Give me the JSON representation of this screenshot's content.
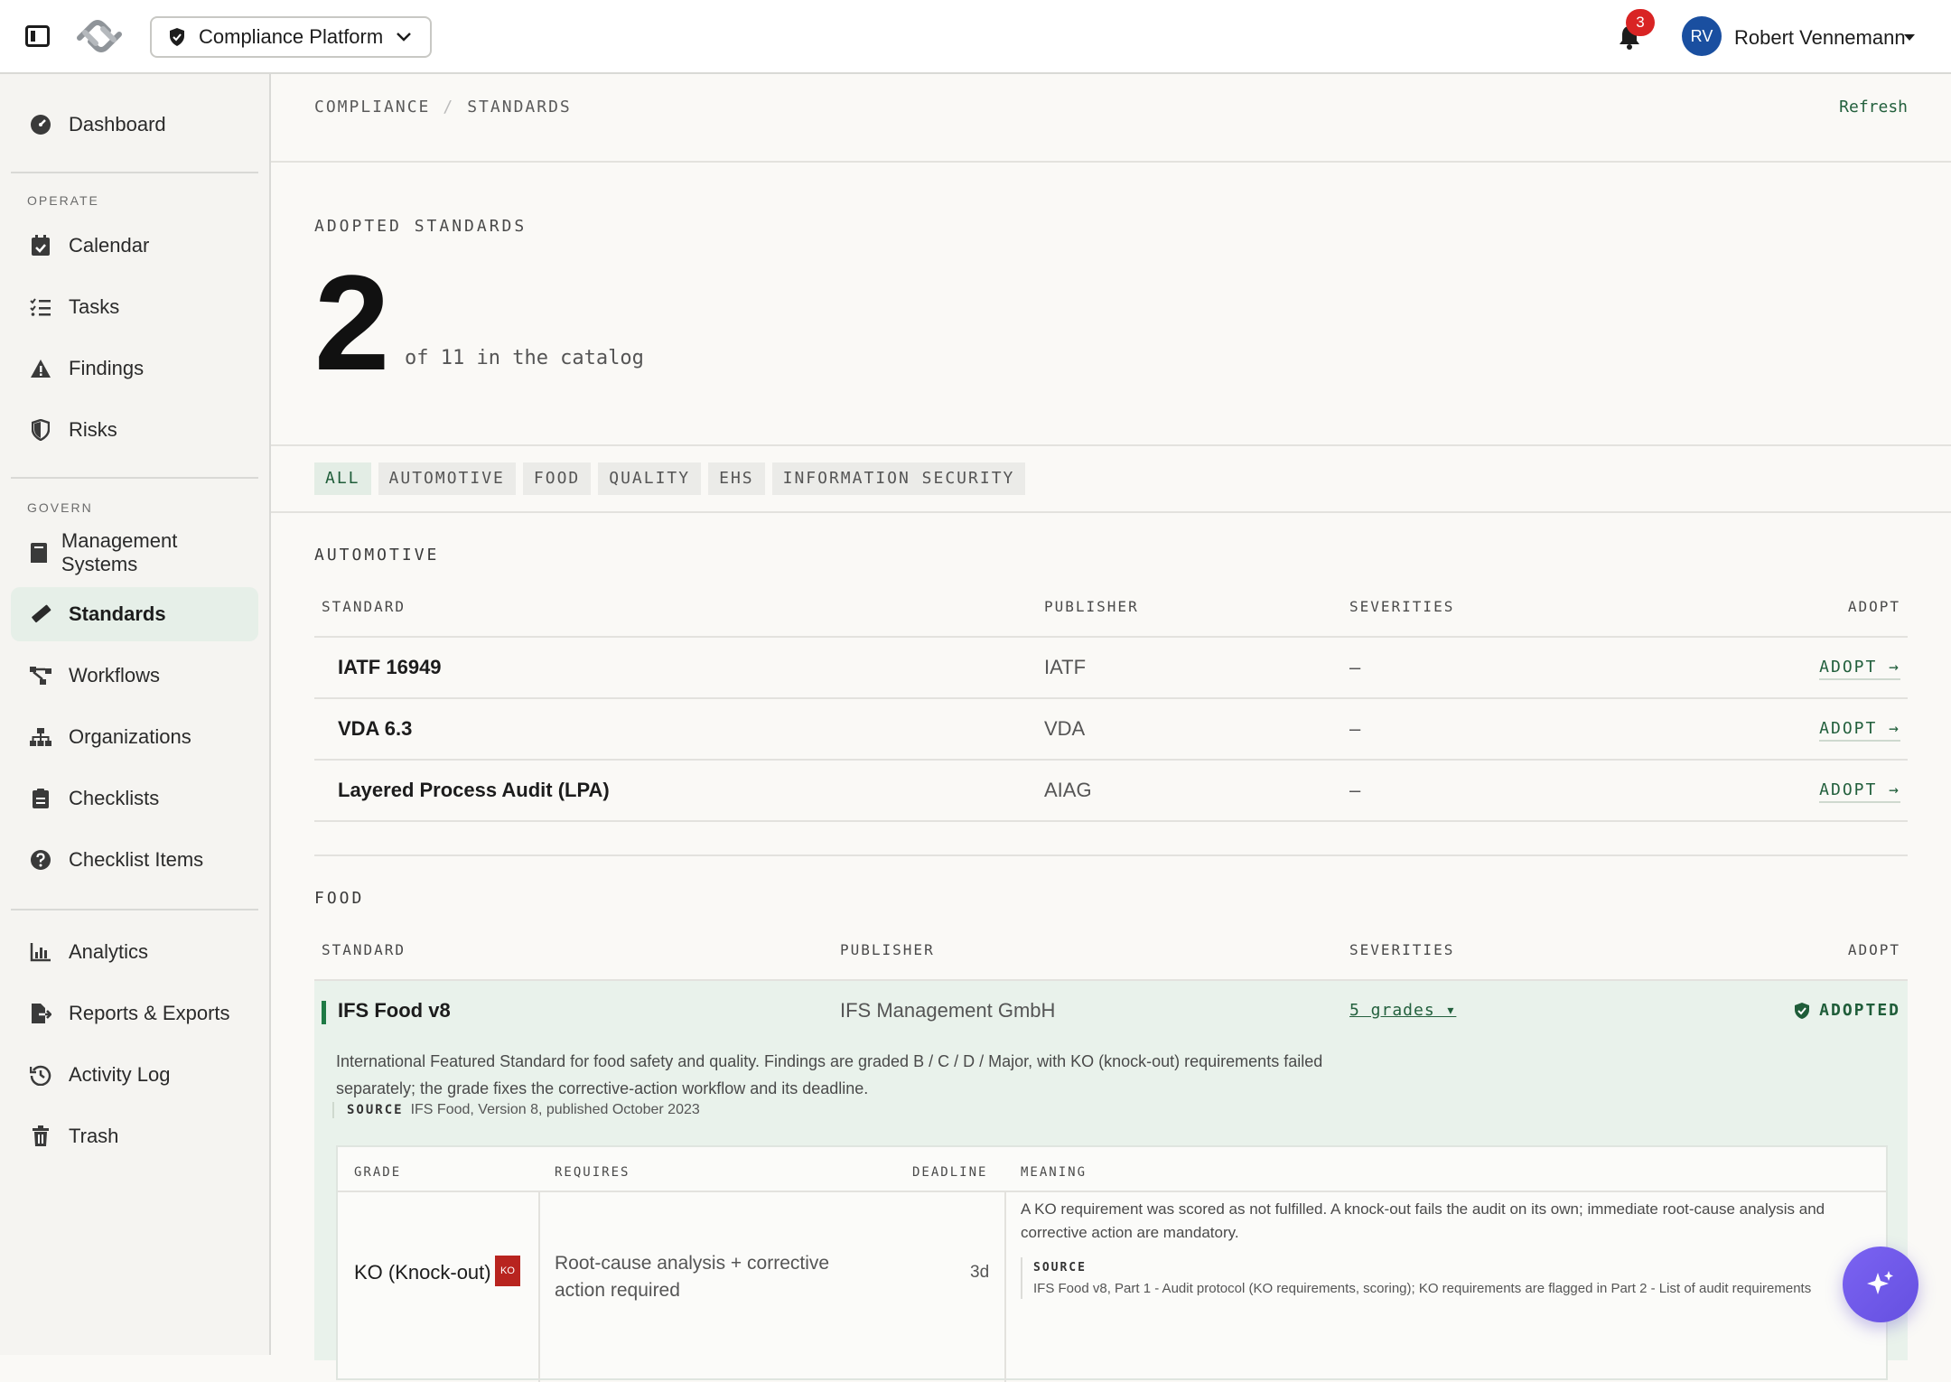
{
  "topbar": {
    "platform": "Compliance Platform",
    "notification_count": "3",
    "user_initials": "RV",
    "user_name": "Robert Vennemann"
  },
  "sidebar": {
    "dashboard": "Dashboard",
    "operate_heading": "OPERATE",
    "operate_items": [
      "Calendar",
      "Tasks",
      "Findings",
      "Risks"
    ],
    "govern_heading": "GOVERN",
    "govern_items": [
      "Management Systems",
      "Standards",
      "Workflows",
      "Organizations",
      "Checklists",
      "Checklist Items"
    ],
    "other_items": [
      "Analytics",
      "Reports & Exports",
      "Activity Log",
      "Trash"
    ],
    "active": "Standards"
  },
  "breadcrumb": {
    "root": "COMPLIANCE",
    "current": "STANDARDS"
  },
  "refresh_label": "Refresh",
  "summary": {
    "kicker": "ADOPTED STANDARDS",
    "adopted_count": "2",
    "subtitle": "of 11 in the catalog"
  },
  "filters": [
    "ALL",
    "AUTOMOTIVE",
    "FOOD",
    "QUALITY",
    "EHS",
    "INFORMATION SECURITY"
  ],
  "columns": {
    "standard": "STANDARD",
    "publisher": "PUBLISHER",
    "severities": "SEVERITIES",
    "adopt": "ADOPT"
  },
  "groups": {
    "automotive": {
      "title": "AUTOMOTIVE",
      "rows": [
        {
          "standard": "IATF 16949",
          "publisher": "IATF",
          "severities": "–",
          "action": "ADOPT →"
        },
        {
          "standard": "VDA 6.3",
          "publisher": "VDA",
          "severities": "–",
          "action": "ADOPT →"
        },
        {
          "standard": "Layered Process Audit (LPA)",
          "publisher": "AIAG",
          "severities": "–",
          "action": "ADOPT →"
        }
      ]
    },
    "food": {
      "title": "FOOD",
      "rows": [
        {
          "standard": "IFS Food v8",
          "publisher": "IFS Management GmbH",
          "severities": "5 grades ▾",
          "action": "ADOPTED",
          "description": "International Featured Standard for food safety and quality. Findings are graded B / C / D / Major, with KO (knock-out) requirements failed separately; the grade fixes the corrective-action workflow and its deadline.",
          "source_label": "SOURCE",
          "source": "IFS Food, Version 8, published October 2023"
        }
      ]
    }
  },
  "grade_table": {
    "columns": {
      "grade": "GRADE",
      "requires": "REQUIRES",
      "deadline": "DEADLINE",
      "meaning": "MEANING"
    },
    "rows": [
      {
        "grade": "KO (Knock-out)",
        "tag": "KO",
        "requires": "Root-cause analysis + corrective action required",
        "deadline": "3d",
        "meaning": "A KO requirement was scored as not fulfilled. A knock-out fails the audit on its own; immediate root-cause analysis and corrective action are mandatory.",
        "source_label": "SOURCE",
        "source": "IFS Food v8, Part 1 - Audit protocol (KO requirements, scoring); KO requirements are flagged in Part 2 - List of audit requirements"
      }
    ]
  },
  "colors": {
    "accent": "#23603d",
    "badge": "#d92424",
    "avatar": "#1a4fa0",
    "fab": "#6f58ea",
    "ko": "#b8241f"
  }
}
